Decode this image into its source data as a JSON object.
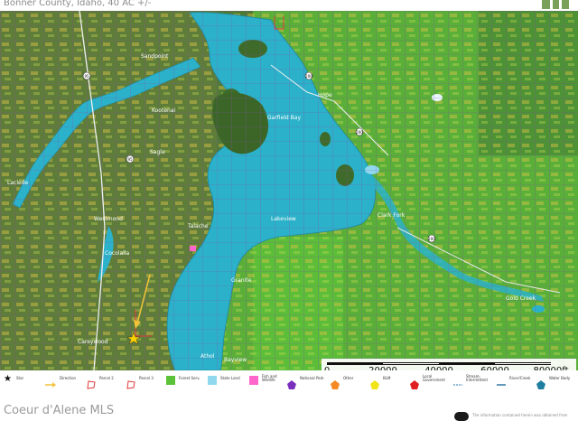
{
  "header": {
    "title": "Bonner County, Idaho, 40 AC +/-",
    "logo": "nw-logo"
  },
  "map": {
    "place_labels": [
      {
        "id": "sandpoint",
        "text": "Sandpoint"
      },
      {
        "id": "kootenai",
        "text": "Kootenai"
      },
      {
        "id": "sagle",
        "text": "Sagle"
      },
      {
        "id": "westmond",
        "text": "Westmond"
      },
      {
        "id": "careywood",
        "text": "Careywood"
      },
      {
        "id": "granite",
        "text": "Granite"
      },
      {
        "id": "lakeview",
        "text": "Lakeview"
      },
      {
        "id": "bayview",
        "text": "Bayview"
      },
      {
        "id": "athol",
        "text": "Athol"
      },
      {
        "id": "cocolalla",
        "text": "Cocolalla"
      },
      {
        "id": "laclede",
        "text": "Laclede"
      },
      {
        "id": "garfield-bay",
        "text": "Garfield Bay"
      },
      {
        "id": "talache",
        "text": "Talache"
      },
      {
        "id": "hope",
        "text": "Hope"
      },
      {
        "id": "clark-fork",
        "text": "Clark Fork"
      },
      {
        "id": "gold-creek",
        "text": "Gold Creek"
      }
    ],
    "highway_shields": [
      "95",
      "200",
      "95",
      "200",
      "200"
    ],
    "colors": {
      "water": "#2bb1c9",
      "forest_service": "#5cc23a",
      "state_land": "#8fd8ee",
      "national_park": "#7b2fbf",
      "blm": "#f2e41a",
      "local_government": "#e02020",
      "other": "#f58a24",
      "fish_wildlife": "#ff66cc",
      "parcel_line": "#e03b3b",
      "grid_line": "#7b3f9e"
    }
  },
  "scale": {
    "labels": [
      "0",
      "20000",
      "40000",
      "60000",
      "80000ft"
    ]
  },
  "legend": {
    "items": [
      {
        "label": "Star",
        "icon": "star-icon"
      },
      {
        "label": "Direction",
        "icon": "direction-arrow-icon"
      },
      {
        "label": "Parcel 2",
        "icon": "parcel-2-icon"
      },
      {
        "label": "Parcel 3",
        "icon": "parcel-3-icon"
      },
      {
        "label": "Forest Serv.",
        "icon": "forest-service-swatch"
      },
      {
        "label": "State Land",
        "icon": "state-land-swatch"
      },
      {
        "label": "Fish and\nWildlife",
        "icon": "fish-wildlife-swatch"
      },
      {
        "label": "National Park",
        "icon": "national-park-swatch"
      },
      {
        "label": "Other",
        "icon": "other-swatch"
      },
      {
        "label": "BLM",
        "icon": "blm-swatch"
      },
      {
        "label": "Local\nGovernment",
        "icon": "local-government-swatch"
      },
      {
        "label": "Stream-\nIntermittent",
        "icon": "stream-intermittent-icon"
      },
      {
        "label": "River/Creek",
        "icon": "river-creek-icon"
      },
      {
        "label": "Water Body",
        "icon": "water-body-swatch"
      }
    ]
  },
  "footer": {
    "watermark": "Coeur d'Alene MLS",
    "disclaimer": "The information contained herein was obtained from"
  }
}
